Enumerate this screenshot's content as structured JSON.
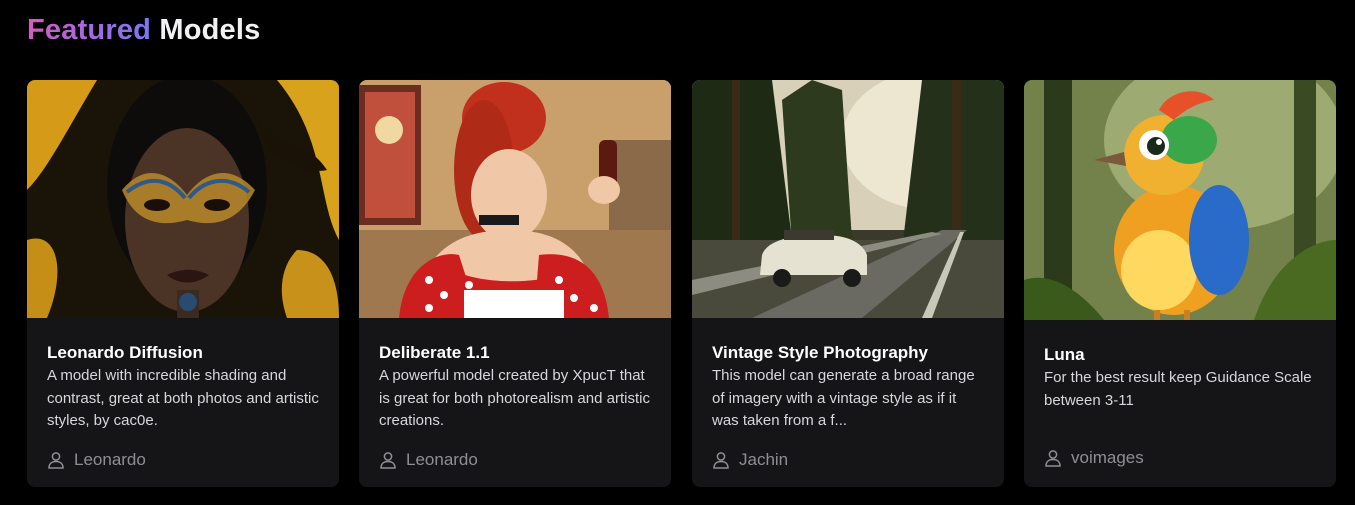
{
  "heading": {
    "accent": "Featured",
    "rest": "Models",
    "accent_gradient": [
      "#d75cbf",
      "#7b78f2"
    ]
  },
  "cards": [
    {
      "title": "Leonardo Diffusion",
      "description": "A model with incredible shading and contrast, great at both photos and artistic styles, by cac0e.",
      "author": "Leonardo",
      "image_icon": "portrait-mask-image"
    },
    {
      "title": "Deliberate 1.1",
      "description": "A powerful model created by XpucT that is great for both photorealism and artistic creations.",
      "author": "Leonardo",
      "image_icon": "retro-pinup-image"
    },
    {
      "title": "Vintage Style Photography",
      "description": "This model can generate a broad range of imagery with a vintage style as if it was taken from a f...",
      "author": "Jachin",
      "image_icon": "vintage-car-road-image"
    },
    {
      "title": "Luna",
      "description": "For the best result keep Guidance Scale between 3-11",
      "author": "voimages",
      "image_icon": "cartoon-bird-image"
    }
  ],
  "author_icon": "user-icon"
}
